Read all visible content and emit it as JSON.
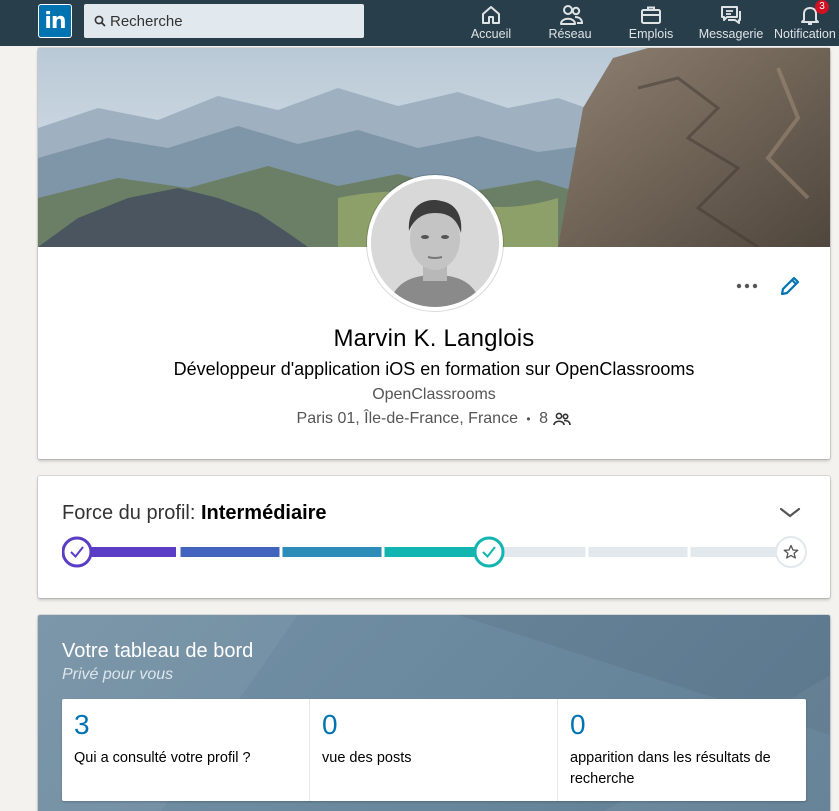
{
  "topnav": {
    "logo_text": "in",
    "search": {
      "placeholder": "Recherche"
    },
    "items": [
      {
        "label": "Accueil",
        "icon": "home-icon"
      },
      {
        "label": "Réseau",
        "icon": "network-icon"
      },
      {
        "label": "Emplois",
        "icon": "briefcase-icon"
      },
      {
        "label": "Messagerie",
        "icon": "messaging-icon"
      },
      {
        "label": "Notification",
        "icon": "bell-icon",
        "badge": "3"
      }
    ]
  },
  "profile": {
    "name": "Marvin K. Langlois",
    "headline": "Développeur d'application iOS en formation sur OpenClassrooms",
    "company": "OpenClassrooms",
    "location": "Paris 01, Île-de-France, France",
    "separator": "•",
    "connections": "8"
  },
  "profile_strength": {
    "label": "Force du profil:",
    "level": "Intermédiaire",
    "steps_total": 7,
    "steps_completed": 4
  },
  "dashboard": {
    "title": "Votre tableau de bord",
    "subtitle": "Privé pour vous",
    "stats": [
      {
        "value": "3",
        "label": "Qui a consulté votre profil ?"
      },
      {
        "value": "0",
        "label": "vue des posts"
      },
      {
        "value": "0",
        "label": "apparition dans les résultats de recherche"
      }
    ]
  },
  "colors": {
    "nav_bg": "#283e4a",
    "brand_blue": "#0073b1",
    "badge_red": "#d11124",
    "meter_start": "#5b3cc4",
    "meter_end": "#13b5b1"
  }
}
